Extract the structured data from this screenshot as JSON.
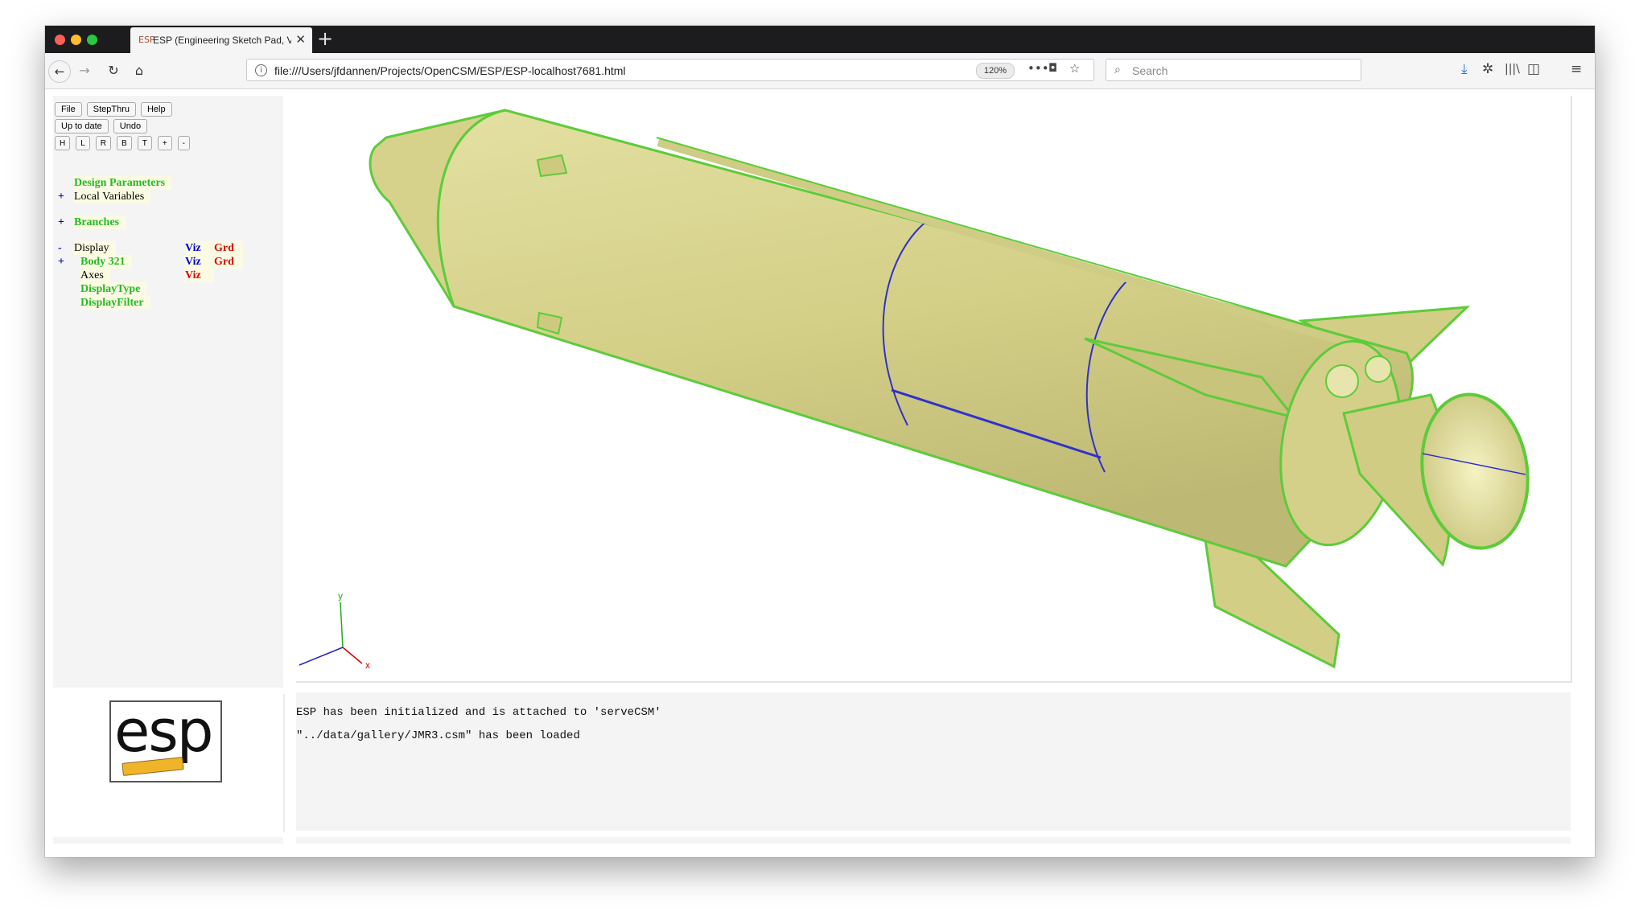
{
  "browser": {
    "tab_title": "ESP (Engineering Sketch Pad, V",
    "tab_icon": "esp-favicon",
    "url": "file:///Users/jfdannen/Projects/OpenCSM/ESP/ESP-localhost7681.html",
    "zoom": "120%",
    "search_placeholder": "Search"
  },
  "toolbar": {
    "row1": [
      "File",
      "StepThru",
      "Help"
    ],
    "row2": [
      "Up to date",
      "Undo"
    ],
    "row3": [
      "H",
      "L",
      "R",
      "B",
      "T",
      "+",
      "-"
    ]
  },
  "tree": {
    "design_parameters": "Design Parameters",
    "local_variables": "Local Variables",
    "branches": "Branches",
    "display": "Display",
    "body": "Body 321",
    "axes": "Axes",
    "display_type": "DisplayType",
    "display_filter": "DisplayFilter",
    "plus": "+",
    "minus": "-",
    "viz": "Viz",
    "grd": "Grd"
  },
  "logo_text": "esp",
  "messages": [
    "ESP has been initialized and is attached to 'serveCSM'",
    "\"../data/gallery/JMR3.csm\" has been loaded"
  ],
  "axes_labels": {
    "x": "x",
    "y": "y"
  },
  "colors": {
    "model_fill": "#d8d58e",
    "model_edge": "#5ccc3a",
    "viz": "#0000cc",
    "grd": "#dd0000",
    "tree_green": "#22bb22"
  }
}
